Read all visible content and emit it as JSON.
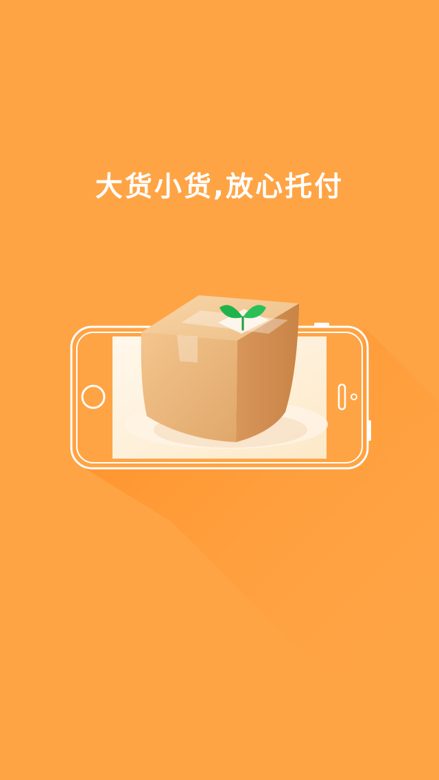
{
  "splash": {
    "slogan": "大货小货,放心托付",
    "background_color": "#FFA445",
    "shadow_color": "#FF9328",
    "illustration": {
      "device": "phone-landscape",
      "item": "cardboard-box",
      "decoration": "sprout-icon"
    }
  }
}
